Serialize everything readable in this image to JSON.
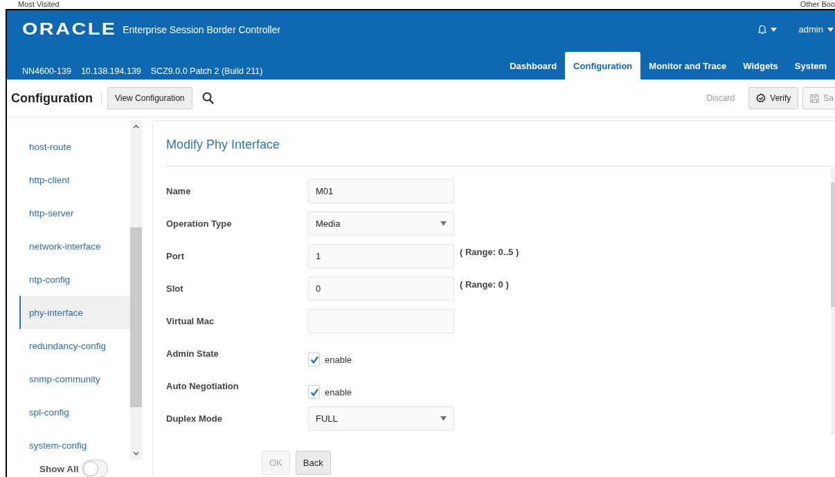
{
  "bookmarks": {
    "left": "Most Visited",
    "right": "Other Boo"
  },
  "header": {
    "logo": "ORACLE",
    "product": "Enterprise Session Border Controller",
    "user": "admin",
    "device": "NN4600-139",
    "ip": "10.138.194.139",
    "version": "SCZ9.0.0 Patch 2 (Build 211)"
  },
  "tabs": [
    {
      "label": "Dashboard",
      "selected": false
    },
    {
      "label": "Configuration",
      "selected": true
    },
    {
      "label": "Monitor and Trace",
      "selected": false
    },
    {
      "label": "Widgets",
      "selected": false
    },
    {
      "label": "System",
      "selected": false
    }
  ],
  "toolbar": {
    "title": "Configuration",
    "view_button": "View Configuration",
    "actions": [
      {
        "kind": "link",
        "label": "Discard",
        "disabled": true
      },
      {
        "kind": "verify",
        "label": "Verify",
        "disabled": false
      },
      {
        "kind": "save",
        "label": "Sa",
        "disabled": true
      }
    ]
  },
  "sidebar": {
    "items": [
      {
        "label": "host-route",
        "selected": false
      },
      {
        "label": "http-client",
        "selected": false
      },
      {
        "label": "http-server",
        "selected": false
      },
      {
        "label": "network-interface",
        "selected": false
      },
      {
        "label": "ntp-config",
        "selected": false
      },
      {
        "label": "phy-interface",
        "selected": true
      },
      {
        "label": "redundancy-config",
        "selected": false
      },
      {
        "label": "snmp-community",
        "selected": false
      },
      {
        "label": "spl-config",
        "selected": false
      },
      {
        "label": "system-config",
        "selected": false
      }
    ],
    "show_all": {
      "label": "Show All",
      "on": false
    }
  },
  "form": {
    "title": "Modify Phy Interface",
    "fields": [
      {
        "kind": "text",
        "label": "Name",
        "value": "M01"
      },
      {
        "kind": "select",
        "label": "Operation Type",
        "value": "Media"
      },
      {
        "kind": "text",
        "label": "Port",
        "value": "1",
        "hint": "( Range: 0..5 )"
      },
      {
        "kind": "text",
        "label": "Slot",
        "value": "0",
        "hint": "( Range: 0 )"
      },
      {
        "kind": "text",
        "label": "Virtual Mac"
      },
      {
        "kind": "checkbox",
        "label": "Admin State",
        "option": "enable",
        "checked": true
      },
      {
        "kind": "checkbox",
        "label": "Auto Negotiation",
        "option": "enable",
        "checked": true
      },
      {
        "kind": "select",
        "label": "Duplex Mode",
        "value": "FULL"
      }
    ],
    "buttons": [
      {
        "label": "OK",
        "disabled": true
      },
      {
        "label": "Back",
        "disabled": false
      }
    ]
  }
}
